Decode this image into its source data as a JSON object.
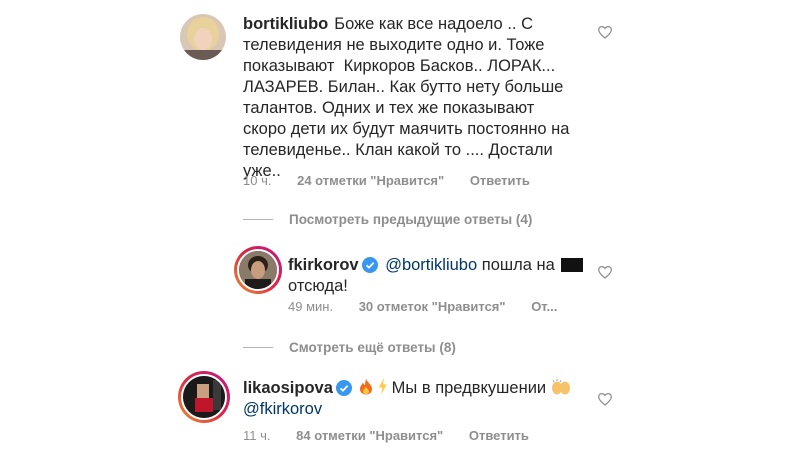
{
  "comments": [
    {
      "username": "bortikliubo",
      "text_lines": [
        "Боже как все надоело .. С",
        "телевидения не выходите одно и. Тоже",
        "показывают  Киркоров Басков.. ЛОРАК...",
        "ЛАЗАРЕВ. Билан.. Как бутто нету больше",
        "талантов. Одних и тех же показывают",
        "скоро дети их будут маячить постоянно на",
        "телевиденье.. Клан какой то .... Достали",
        "уже.."
      ],
      "time": "10 ч.",
      "likes": "24 отметки \"Нравится\"",
      "reply": "Ответить",
      "view_replies": "Посмотреть предыдущие ответы (4)"
    },
    {
      "username": "fkirkorov",
      "mention": "@bortikliubo",
      "text_part1": "пошла на",
      "text_line2": "отсюда!",
      "time": "49 мин.",
      "likes": "30 отметок \"Нравится\"",
      "reply": "От...",
      "view_replies": "Смотреть ещё ответы (8)"
    },
    {
      "username": "likaosipova",
      "text_part1": "Мы в предвкушении",
      "mention": "@fkirkorov",
      "time": "11 ч.",
      "likes": "84 отметки \"Нравится\"",
      "reply": "Ответить"
    }
  ],
  "icons": {
    "like": "heart-outline-icon",
    "verified": "verified-badge-icon",
    "fire": "fire-emoji-icon",
    "lightning": "lightning-emoji-icon",
    "hands": "raising-hands-emoji-icon"
  },
  "colors": {
    "text": "#262626",
    "secondary": "#8e8e8e",
    "mention": "#00376b",
    "verified": "#3897f0",
    "story_ring": "#c13584"
  }
}
